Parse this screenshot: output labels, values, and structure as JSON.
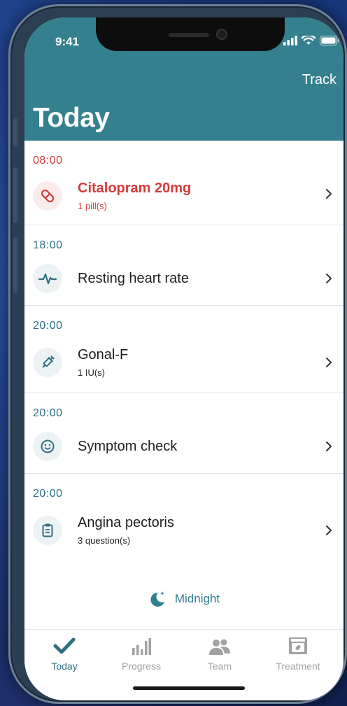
{
  "status_bar": {
    "time": "9:41"
  },
  "header": {
    "track_label": "Track",
    "title": "Today"
  },
  "sections": [
    {
      "time": "08:00",
      "title": "Citalopram 20mg",
      "subtitle": "1 pill(s)",
      "icon": "pill-icon"
    },
    {
      "time": "18:00",
      "title": "Resting heart rate",
      "subtitle": "",
      "icon": "heart-rate-icon"
    },
    {
      "time": "20:00",
      "title": "Gonal-F",
      "subtitle": "1 IU(s)",
      "icon": "syringe-icon"
    },
    {
      "time": "20:00",
      "title": "Symptom check",
      "subtitle": "",
      "icon": "smiley-icon"
    },
    {
      "time": "20:00",
      "title": "Angina pectoris",
      "subtitle": "3 question(s)",
      "icon": "clipboard-icon"
    }
  ],
  "midnight_label": "Midnight",
  "tabs": [
    {
      "label": "Today",
      "icon": "checkmark-icon",
      "active": true
    },
    {
      "label": "Progress",
      "icon": "bar-chart-icon",
      "active": false
    },
    {
      "label": "Team",
      "icon": "team-icon",
      "active": false
    },
    {
      "label": "Treatment",
      "icon": "treatment-icon",
      "active": false
    }
  ],
  "colors": {
    "header": "#34808f",
    "accent": "#2f6f82",
    "alert": "#d23b3b",
    "inactive": "#a2a2a2"
  }
}
